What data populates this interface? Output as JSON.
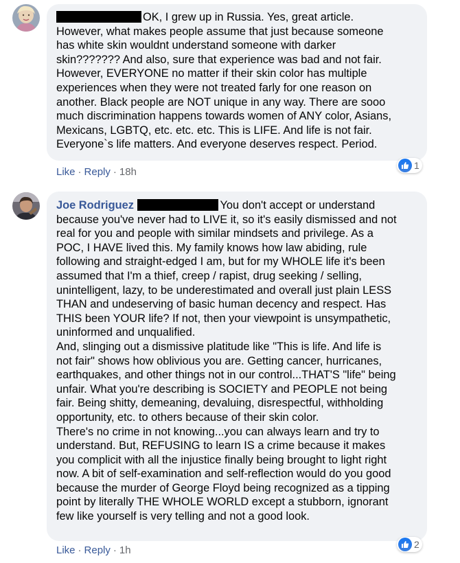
{
  "comments": [
    {
      "lines": [
        "OK, I grew up in Russia. Yes, great article.",
        "However, what makes people assume that just because someone",
        "has white skin wouldnt understand someone with darker",
        "skin??????? And also, sure that experience was bad and not fair.",
        "However, EVERYONE no matter if their skin color has multiple",
        "experiences when they were not treated farly for one reason on",
        "another. Black people are NOT unique in any way. There are sooo",
        "much discrimination happens towards women of ANY color, Asians,",
        "Mexicans, LGBTQ, etc. etc. etc. This is LIFE. And life is not fair.",
        "Everyone`s life matters. And everyone deserves respect. Period."
      ],
      "like_label": "Like",
      "reply_label": "Reply",
      "time": "18h",
      "reaction_count": "1",
      "reaction_icon": "thumbs-up-icon"
    },
    {
      "author": "Joe Rodriguez",
      "lines": [
        "You don't accept or understand",
        "because you've never had to LIVE it, so it's easily dismissed and not",
        "real for you and people with similar mindsets and privilege. As a",
        "POC, I HAVE lived this. My family knows how law abiding, rule",
        "following and straight-edged I am, but for my WHOLE life it's been",
        "assumed that I'm a thief, creep / rapist, drug seeking / selling,",
        "unintelligent, lazy, to be underestimated and overall just plain LESS",
        "THAN and undeserving of basic human decency and respect. Has",
        "THIS been YOUR life? If not, then your viewpoint is unsympathetic,",
        "uninformed and unqualified.",
        "And, slinging out a dismissive platitude like \"This is life. And life is",
        "not fair\" shows how oblivious you are. Getting cancer, hurricanes,",
        "earthquakes, and other things not in our control...THAT'S \"life\" being",
        "unfair. What you're describing is SOCIETY and PEOPLE not being",
        "fair. Being shitty, demeaning, devaluing, disrespectful, withholding",
        "opportunity, etc. to others because of their skin color.",
        "There's no crime in not knowing...you can always learn and try to",
        "understand. But, REFUSING to learn IS a crime because it makes",
        "you complicit with all the injustice finally being brought to light right",
        "now. A bit of self-examination and self-reflection would do you good",
        "because the murder of George Floyd being recognized as a tipping",
        "point by literally THE WHOLE WORLD except a stubborn, ignorant",
        "few like yourself is very telling and not a good look."
      ],
      "like_label": "Like",
      "reply_label": "Reply",
      "time": "1h",
      "reaction_count": "2",
      "reaction_icon": "thumbs-up-icon"
    }
  ],
  "colors": {
    "bubble": "#f0f2f5",
    "link": "#385898",
    "meta": "#65676b",
    "like_blue": "#1877f2"
  }
}
